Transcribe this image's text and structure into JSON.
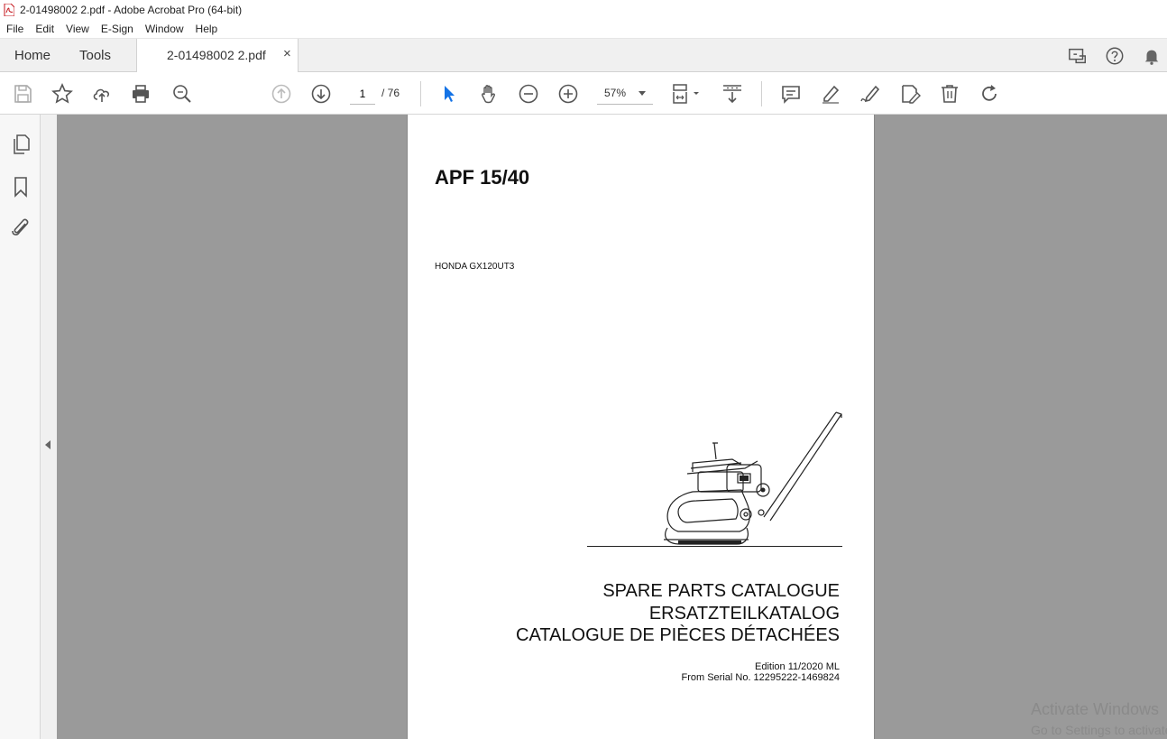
{
  "window": {
    "title": "2-01498002 2.pdf - Adobe Acrobat Pro (64-bit)"
  },
  "menu": [
    "File",
    "Edit",
    "View",
    "E-Sign",
    "Window",
    "Help"
  ],
  "tabs": {
    "home": "Home",
    "tools": "Tools",
    "document": "2-01498002 2.pdf",
    "close": "×"
  },
  "toolbar": {
    "page_current": "1",
    "page_total": "/ 76",
    "zoom": "57%"
  },
  "document": {
    "title": "APF 15/40",
    "engine": "HONDA GX120UT3",
    "heading_en": "SPARE PARTS CATALOGUE",
    "heading_de": "ERSATZTEILKATALOG",
    "heading_fr": "CATALOGUE DE PIÈCES DÉTACHÉES",
    "edition": "Edition 11/2020 ML",
    "serial": "From Serial No. 12295222-1469824"
  },
  "watermark": {
    "line1": "Activate Windows",
    "line2": "Go to Settings to activate Windows."
  },
  "colors": {
    "accent": "#1473e6",
    "background": "#9a9a9a"
  }
}
